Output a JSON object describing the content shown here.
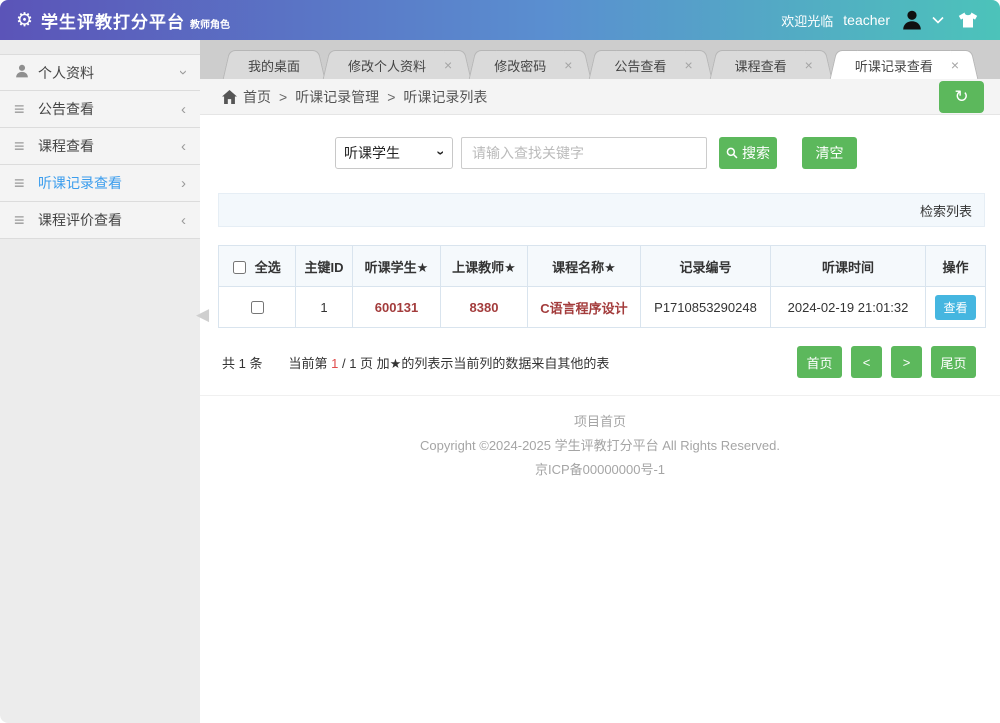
{
  "header": {
    "title": "学生评教打分平台",
    "role": "教师角色",
    "welcome": "欢迎光临",
    "username": "teacher"
  },
  "icons": {
    "gear": "⚙",
    "hamburger": "≡",
    "chevron_left": "‹",
    "chevron_right": "›",
    "close": "×",
    "refresh": "↻",
    "collapse_arrow": "◀"
  },
  "sidebar": {
    "items": [
      {
        "label": "个人资料"
      },
      {
        "label": "公告查看"
      },
      {
        "label": "课程查看"
      },
      {
        "label": "听课记录查看"
      },
      {
        "label": "课程评价查看"
      }
    ]
  },
  "tabs": {
    "items": [
      {
        "label": "我的桌面"
      },
      {
        "label": "修改个人资料"
      },
      {
        "label": "修改密码"
      },
      {
        "label": "公告查看"
      },
      {
        "label": "课程查看"
      },
      {
        "label": "听课记录查看"
      }
    ]
  },
  "breadcrumb": {
    "separator": ">",
    "home": "首页",
    "level2": "听课记录管理",
    "level3": "听课记录列表"
  },
  "search": {
    "category": "听课学生",
    "placeholder": "请输入查找关键字",
    "search_label": "搜索",
    "clear_label": "清空"
  },
  "panel": {
    "title": "检索列表"
  },
  "table": {
    "columns": [
      "全选",
      "主键ID",
      "听课学生★",
      "上课教师★",
      "课程名称★",
      "记录编号",
      "听课时间",
      "操作"
    ],
    "rows": [
      {
        "cells": [
          "1",
          "600131",
          "8380",
          "C语言程序设计",
          "P1710853290248",
          "2024-02-19 21:01:32"
        ],
        "action": "查看"
      }
    ]
  },
  "pagination": {
    "total": "共 1 条",
    "current_prefix": "当前第",
    "current_page": "1",
    "page_suffix": "/ 1 页",
    "note": "加★的列表示当前列的数据来自其他的表",
    "first": "首页",
    "prev": "<",
    "next": ">",
    "last": "尾页"
  },
  "footer": {
    "home_link": "项目首页",
    "copyright": "Copyright ©2024-2025 学生评教打分平台 All Rights Reserved.",
    "icp": "京ICP备00000000号-1"
  },
  "colors": {
    "accent_green": "#5cb85c",
    "action_blue": "#45b6e0",
    "data_red": "#a33c3c",
    "active_menu_blue": "#3b9ded",
    "header_gradient_start": "#5b54b8",
    "header_gradient_end": "#4cc3ba"
  }
}
